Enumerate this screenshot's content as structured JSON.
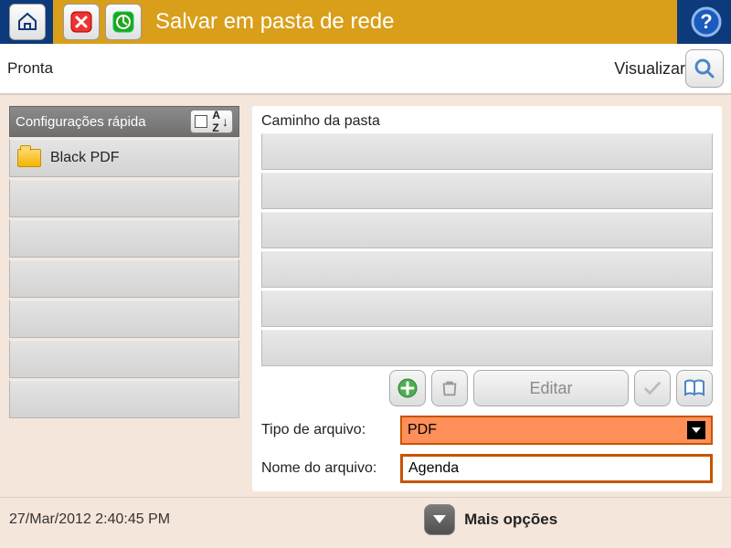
{
  "titlebar": {
    "title": "Salvar em pasta de rede"
  },
  "status": {
    "ready": "Pronta",
    "visualizar": "Visualizar"
  },
  "quicksets": {
    "header": "Configurações rápida",
    "sort": "A↓Z",
    "items": [
      {
        "label": "Black PDF"
      }
    ]
  },
  "folder": {
    "path_label": "Caminho da pasta",
    "edit": "Editar",
    "filetype_label": "Tipo de arquivo:",
    "filetype_value": "PDF",
    "filename_label": "Nome do arquivo:",
    "filename_value": "Agenda"
  },
  "footer": {
    "timestamp": "27/Mar/2012 2:40:45 PM",
    "more": "Mais opções"
  }
}
